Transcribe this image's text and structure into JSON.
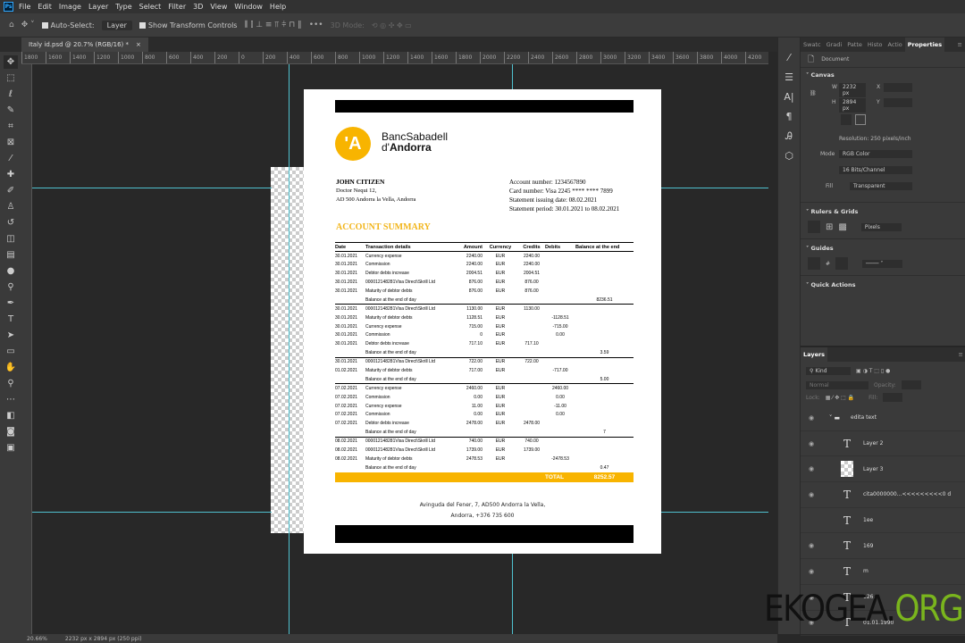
{
  "app": {
    "logo": "Ps",
    "menu": [
      "File",
      "Edit",
      "Image",
      "Layer",
      "Type",
      "Select",
      "Filter",
      "3D",
      "View",
      "Window",
      "Help"
    ]
  },
  "options": {
    "auto_select_label": "Auto-Select:",
    "auto_select_value": "Layer",
    "transform_label": "Show Transform Controls",
    "mode_3d": "3D Mode:",
    "more": "•••"
  },
  "document_tab": {
    "title": "Italy id.psd @ 20.7% (RGB/16) *",
    "close": "×"
  },
  "ruler": [
    "1800",
    "1600",
    "1400",
    "1200",
    "1000",
    "800",
    "600",
    "400",
    "200",
    "0",
    "200",
    "400",
    "600",
    "800",
    "1000",
    "1200",
    "1400",
    "1600",
    "1800",
    "2000",
    "2200",
    "2400",
    "2600",
    "2800",
    "3000",
    "3200",
    "3400",
    "3600",
    "3800",
    "4000",
    "4200"
  ],
  "statement": {
    "logo_mark": "'A",
    "bank_line1": "BancSabadell",
    "bank_line2_prefix": "d'",
    "bank_line2": "Andorra",
    "customer": {
      "name": "JOHN CITIZEN",
      "address1": "Doctor Nequi 12,",
      "address2": "AD 500 Andorra la Vella, Andorra"
    },
    "account": {
      "number": "Account number:   1234567890",
      "card": "Card number:  Visa 2245 **** **** 7899",
      "issue_date": "Statement issuing date:  08.02.2021",
      "period": "Statement period: 30.01.2021 to 08.02.2021"
    },
    "summary_title": "ACCOUNT SUMMARY",
    "columns": [
      "Date",
      "Transaction details",
      "Amount",
      "Currency",
      "Credits",
      "Debits",
      "Balance at the end"
    ],
    "balance_label": "Balance at the end of day",
    "groups": [
      {
        "rows": [
          [
            "30.01.2021",
            "Currency expense",
            "2240.00",
            "EUR",
            "2240.00",
            ""
          ],
          [
            "30.01.2021",
            "Commission",
            "2240.00",
            "EUR",
            "2240.00",
            ""
          ],
          [
            "30.01.2021",
            "Debtor debts increase",
            "2004.51",
            "EUR",
            "2004.51",
            ""
          ],
          [
            "30.01.2021",
            "000012148281Visa Direct\\Skrill Ltd",
            "876.00",
            "EUR",
            "876.00",
            ""
          ],
          [
            "30.01.2021",
            "Maturity of debtor debts",
            "876.00",
            "EUR",
            "876.00",
            ""
          ]
        ],
        "balance": "8236.51"
      },
      {
        "rows": [
          [
            "30.01.2021",
            "000012148281Visa Direct\\Skrill Ltd",
            "1130.00",
            "EUR",
            "1130.00",
            ""
          ],
          [
            "30.01.2021",
            "Maturity of debtor debts",
            "1128.51",
            "EUR",
            "",
            "-1128.51"
          ],
          [
            "30.01.2021",
            "Currency expense",
            "715.00",
            "EUR",
            "",
            "-715.00"
          ],
          [
            "30.01.2021",
            "Commission",
            "0",
            "EUR",
            "",
            "0.00"
          ],
          [
            "30.01.2021",
            "Debtor debts increase",
            "717.10",
            "EUR",
            "717.10",
            ""
          ]
        ],
        "balance": "3.59"
      },
      {
        "rows": [
          [
            "30.01.2021",
            "000012148281Visa Direct\\Skrill Ltd",
            "722.00",
            "EUR",
            "722.00",
            ""
          ],
          [
            "01.02.2021",
            "Maturity of debtor debts",
            "717.00",
            "EUR",
            "",
            "-717.00"
          ]
        ],
        "balance": "5.00"
      },
      {
        "rows": [
          [
            "07.02.2021",
            "Currency expense",
            "2460.00",
            "EUR",
            "",
            "2460.00"
          ],
          [
            "07.02.2021",
            "Commission",
            "0.00",
            "EUR",
            "",
            "0.00"
          ],
          [
            "07.02.2021",
            "Currency expense",
            "11.00",
            "EUR",
            "",
            "-11.00"
          ],
          [
            "07.02.2021",
            "Commission",
            "0.00",
            "EUR",
            "",
            "0.00"
          ],
          [
            "07.02.2021",
            "Debtor debts increase",
            "2478.00",
            "EUR",
            "2478.00",
            ""
          ]
        ],
        "balance": "7"
      },
      {
        "rows": [
          [
            "08.02.2021",
            "000012148281Visa Direct\\Skrill Ltd",
            "740.00",
            "EUR",
            "740.00",
            ""
          ],
          [
            "08.02.2021",
            "000012148281Visa Direct\\Skrill Ltd",
            "1739.00",
            "EUR",
            "1739.00",
            ""
          ],
          [
            "08.02.2021",
            "Maturity of debtor debts",
            "2478.53",
            "EUR",
            "",
            "-2478.53"
          ]
        ],
        "balance": "0.47"
      }
    ],
    "total_label": "TOTAL",
    "total_value": "8252.57",
    "footer1": "Avinguda del Fener, 7, AD500 Andorra la Vella,",
    "footer2": "Andorra, +376 735 600"
  },
  "properties": {
    "tabs": [
      "Swatc",
      "Gradi",
      "Patte",
      "Histo",
      "Actio",
      "Properties"
    ],
    "document_label": "Document",
    "canvas_title": "Canvas",
    "w_label": "W",
    "w_value": "2232 px",
    "h_label": "H",
    "h_value": "2894 px",
    "x_label": "X",
    "y_label": "Y",
    "resolution": "Resolution: 250 pixels/inch",
    "mode_label": "Mode",
    "mode_value": "RGB Color",
    "depth_value": "16 Bits/Channel",
    "fill_label": "Fill",
    "fill_value": "Transparent",
    "rulers_title": "Rulers & Grids",
    "units": "Pixels",
    "guides_title": "Guides",
    "quick_actions": "Quick Actions"
  },
  "layers": {
    "title": "Layers",
    "kind": "Kind",
    "blend": "Normal",
    "opacity_label": "Opacity:",
    "lock_label": "Lock:",
    "fill_label": "Fill:",
    "items": [
      {
        "name": "edita text",
        "type": "group"
      },
      {
        "name": "Layer 2",
        "type": "text"
      },
      {
        "name": "Layer 3",
        "type": "image"
      },
      {
        "name": "cita0000000...<<<<<<<<<0 d",
        "type": "text"
      },
      {
        "name": "1ee",
        "type": "text"
      },
      {
        "name": "169",
        "type": "text"
      },
      {
        "name": "m",
        "type": "text"
      },
      {
        "name": "126...",
        "type": "text"
      },
      {
        "name": "01.01.1990",
        "type": "text"
      }
    ]
  },
  "status": {
    "zoom": "20.66%",
    "size": "2232 px x 2894 px (250 ppi)"
  },
  "watermark": {
    "part1": "EKOGEA.",
    "part2": "ORG"
  },
  "colors": {
    "accent": "#f8b400",
    "guide": "#4fc1cf",
    "watermark_green": "#7ab51d"
  }
}
